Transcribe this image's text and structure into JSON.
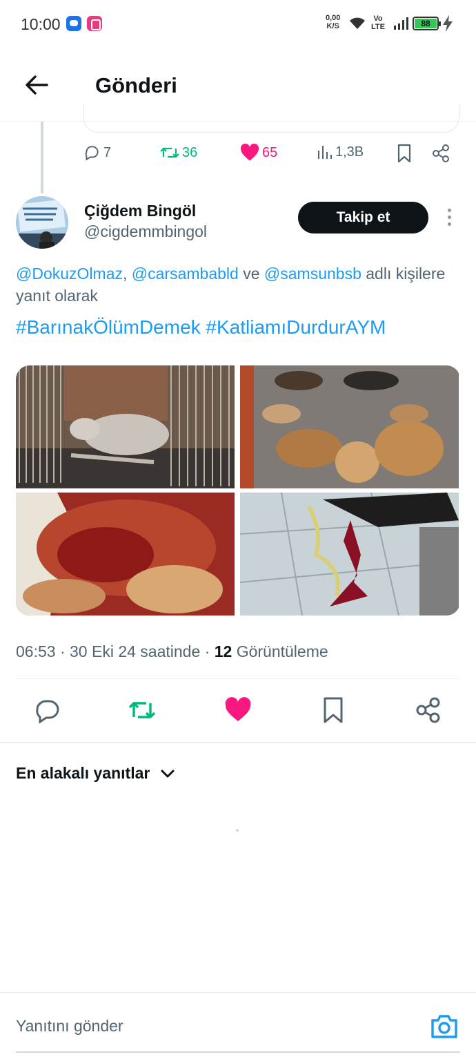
{
  "status_bar": {
    "time": "10:00",
    "net_speed_value": "0,00",
    "net_speed_unit": "K/S",
    "volte_top": "Vo",
    "volte_bottom": "LTE",
    "battery": "88"
  },
  "header": {
    "title": "Gönderi"
  },
  "previous_tweet": {
    "replies": "7",
    "retweets": "36",
    "likes": "65",
    "views": "1,3B"
  },
  "tweet": {
    "author_name": "Çiğdem Bingöl",
    "author_handle": "@cigdemmbingol",
    "follow_label": "Takip et",
    "reply_context": {
      "mention1": "@DokuzOlmaz",
      "sep1": ", ",
      "mention2": "@carsambabld",
      "sep2": " ve ",
      "mention3": "@samsunbsb",
      "suffix": " adlı kişilere yanıt olarak"
    },
    "hashtags": "#BarınakÖlümDemek #KatliamıDurdurAYM",
    "time": "06:53",
    "date": "30 Eki 24 saatinde",
    "view_count": "12",
    "view_label": "Görüntüleme",
    "meta_sep": " · "
  },
  "sort": {
    "label": "En alakalı yanıtlar"
  },
  "compose": {
    "placeholder": "Yanıtını gönder"
  },
  "colors": {
    "accent": "#1d9bf0",
    "retweet": "#00ba7c",
    "like": "#f91880",
    "text": "#0f1419",
    "muted": "#536471"
  }
}
